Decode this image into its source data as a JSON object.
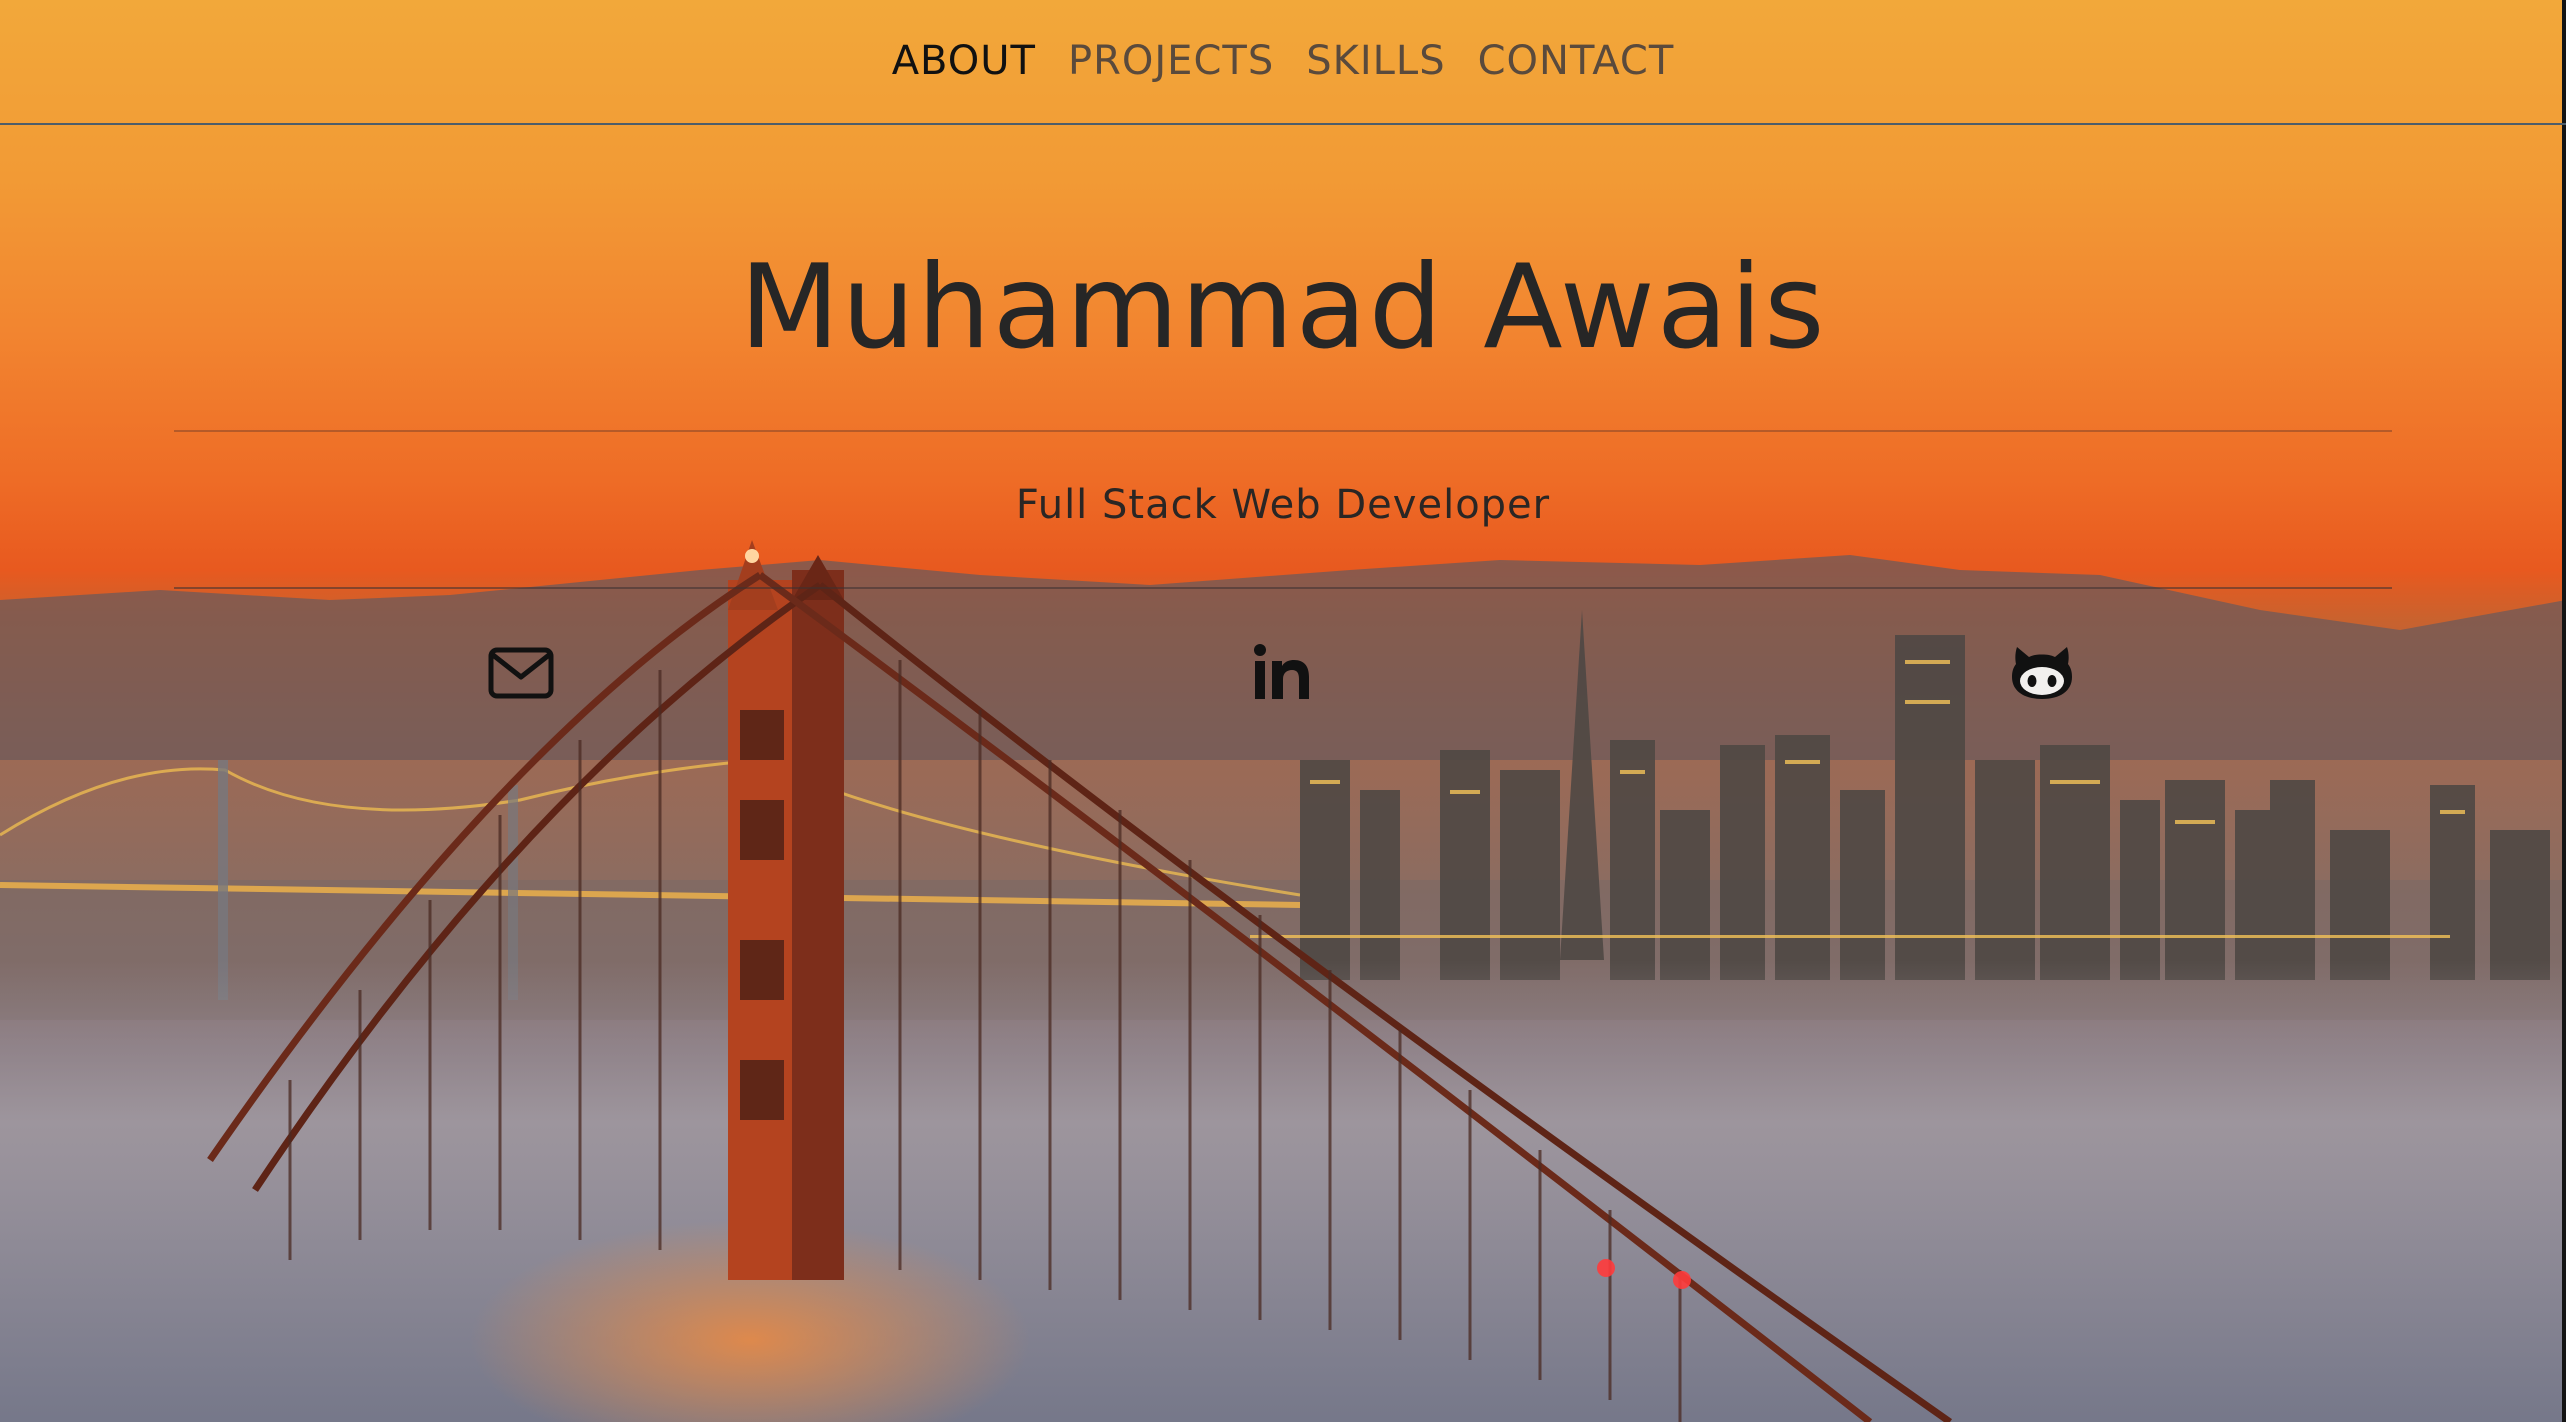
{
  "nav": {
    "items": [
      {
        "label": "ABOUT",
        "active": true
      },
      {
        "label": "PROJECTS",
        "active": false
      },
      {
        "label": "SKILLS",
        "active": false
      },
      {
        "label": "CONTACT",
        "active": false
      }
    ]
  },
  "hero": {
    "name": "Muhammad Awais",
    "subtitle": "Full Stack Web Developer"
  },
  "social": {
    "icons": [
      "envelope-icon",
      "linkedin-icon",
      "github-icon"
    ]
  },
  "colors": {
    "text_dark": "#262626",
    "nav_inactive": "#5a4a3c",
    "nav_active": "#111111"
  }
}
